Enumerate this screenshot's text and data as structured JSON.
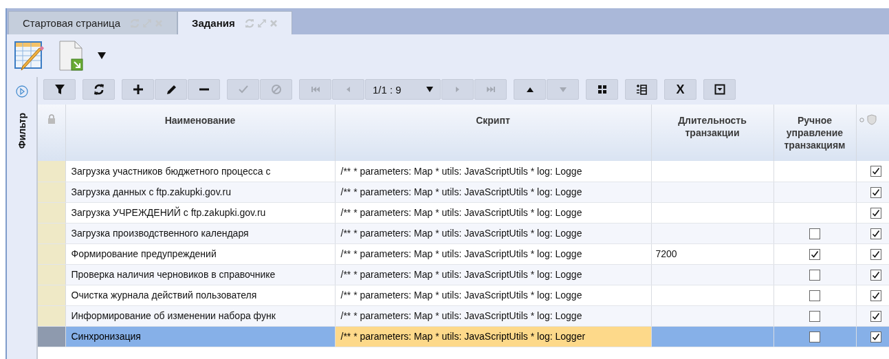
{
  "tabs": [
    {
      "label": "Стартовая страница",
      "selected": false
    },
    {
      "label": "Задания",
      "selected": true
    }
  ],
  "ribbon": {
    "buttons": [
      {
        "kind": "table-edit"
      },
      {
        "kind": "export"
      },
      {
        "kind": "dropdown"
      }
    ]
  },
  "filter_panel": {
    "label": "Фильтр"
  },
  "toolbar": {
    "groups": [
      {
        "buttons": [
          {
            "kind": "filter",
            "disabled": false
          }
        ]
      },
      {
        "buttons": [
          {
            "kind": "refresh",
            "disabled": false
          }
        ]
      },
      {
        "buttons": [
          {
            "kind": "add",
            "disabled": false
          },
          {
            "kind": "edit",
            "disabled": false
          },
          {
            "kind": "remove",
            "disabled": false
          }
        ]
      },
      {
        "buttons": [
          {
            "kind": "apply",
            "disabled": true
          },
          {
            "kind": "cancel",
            "disabled": true
          }
        ]
      },
      {
        "buttons": [
          {
            "kind": "first",
            "disabled": true
          },
          {
            "kind": "prev",
            "disabled": true
          },
          {
            "kind": "pager",
            "text": "1/1 : 9",
            "disabled": false
          },
          {
            "kind": "next",
            "disabled": true
          },
          {
            "kind": "last",
            "disabled": true
          }
        ]
      },
      {
        "buttons": [
          {
            "kind": "up",
            "disabled": false
          },
          {
            "kind": "down",
            "disabled": true
          }
        ]
      },
      {
        "buttons": [
          {
            "kind": "grid",
            "disabled": false
          }
        ]
      },
      {
        "buttons": [
          {
            "kind": "columns",
            "disabled": false
          }
        ]
      },
      {
        "buttons": [
          {
            "kind": "text",
            "text": "X",
            "disabled": false
          }
        ]
      },
      {
        "buttons": [
          {
            "kind": "collapse",
            "disabled": false
          }
        ]
      }
    ]
  },
  "table": {
    "columns": [
      "Наименование",
      "Скрипт",
      "Длительность транзакции",
      "Ручное управление транзакциям"
    ],
    "rows": [
      {
        "name": "Загрузка участников бюджетного процесса с",
        "script": "/** * parameters: Map * utils: JavaScriptUtils * log: Logge",
        "column_6": true,
        "selected": false
      },
      {
        "name": "Загрузка данных с ftp.zakupki.gov.ru",
        "script": "/** * parameters: Map * utils: JavaScriptUtils * log: Logge",
        "column_6": true,
        "selected": false
      },
      {
        "name": "Загрузка УЧРЕЖДЕНИЙ с ftp.zakupki.gov.ru",
        "script": "/** * parameters: Map * utils: JavaScriptUtils * log: Logge",
        "column_6": true,
        "selected": false
      },
      {
        "name": "Загрузка производственного календаря",
        "script": "/** * parameters: Map * utils: JavaScriptUtils * log: Logge",
        "manual": false,
        "column_6": true,
        "selected": false
      },
      {
        "name": "Формирование предупреждений",
        "script": "/** * parameters: Map * utils: JavaScriptUtils * log: Logge",
        "duration": "7200",
        "manual": true,
        "column_6": true,
        "selected": false
      },
      {
        "name": "Проверка наличия черновиков в справочнике",
        "script": "/** * parameters: Map * utils: JavaScriptUtils * log: Logge",
        "manual": false,
        "column_6": true,
        "selected": false
      },
      {
        "name": "Очистка журнала действий пользователя",
        "script": "/** * parameters: Map * utils: JavaScriptUtils * log: Logge",
        "manual": false,
        "column_6": true,
        "selected": false
      },
      {
        "name": "Информирование об изменении набора функ",
        "script": "/** * parameters: Map * utils: JavaScriptUtils * log: Logge",
        "manual": false,
        "column_6": true,
        "selected": false
      },
      {
        "name": "Синхронизация",
        "script": "/** * parameters: Map * utils: JavaScriptUtils * log: Logger",
        "manual": false,
        "column_6": true,
        "selected": true
      }
    ]
  }
}
